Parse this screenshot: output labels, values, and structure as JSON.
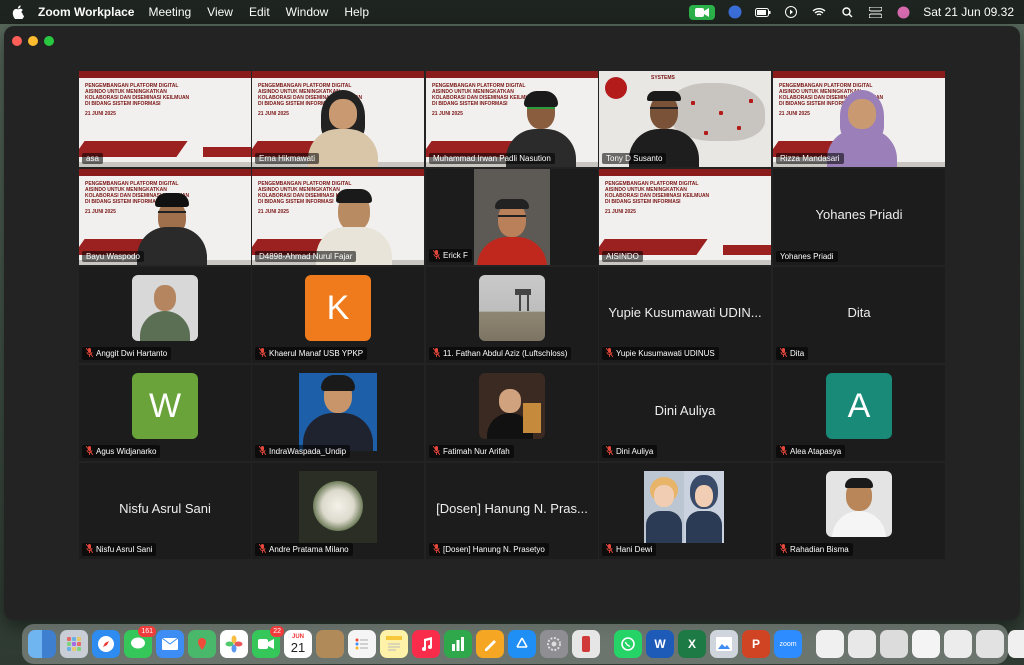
{
  "menubar": {
    "app_name": "Zoom Workplace",
    "menus": [
      "Meeting",
      "View",
      "Edit",
      "Window",
      "Help"
    ],
    "date_time": "Sat 21 Jun  09.32"
  },
  "slide": {
    "title": "PENGEMBANGAN PLATFORM DIGITAL AISINDO UNTUK MENINGKATKAN KOLABORASI DAN DISEMINASI KEILMUAN DI BIDANG SISTEM INFORMASI",
    "date": "21 JUNI 2025"
  },
  "map_slide": {
    "header": "SYSTEMS"
  },
  "participants": [
    {
      "name": "asa",
      "bigname": ""
    },
    {
      "name": "Erna Hikmawati",
      "bigname": ""
    },
    {
      "name": "Muhammad Irwan Padli Nasution",
      "bigname": ""
    },
    {
      "name": "Tony D Susanto",
      "bigname": ""
    },
    {
      "name": "Rizza Mandasari",
      "bigname": ""
    },
    {
      "name": "Bayu Waspodo",
      "bigname": ""
    },
    {
      "name": "D4898-Ahmad Nurul Fajar",
      "bigname": ""
    },
    {
      "name": "Erick F",
      "bigname": ""
    },
    {
      "name": "AISINDO",
      "bigname": ""
    },
    {
      "name": "Yohanes Priadi",
      "bigname": "Yohanes Priadi"
    },
    {
      "name": "Anggit Dwi Hartanto",
      "bigname": ""
    },
    {
      "name": "Khaerul Manaf USB YPKP",
      "bigname": "",
      "letter": "K"
    },
    {
      "name": "11. Fathan Abdul Aziz (Luftschloss)",
      "bigname": ""
    },
    {
      "name": "Yupie Kusumawati UDINUS",
      "bigname": "Yupie Kusumawati UDIN..."
    },
    {
      "name": "Dita",
      "bigname": "Dita"
    },
    {
      "name": "Agus Widjanarko",
      "bigname": "",
      "letter": "W"
    },
    {
      "name": "IndraWaspada_Undip",
      "bigname": ""
    },
    {
      "name": "Fatimah Nur Arifah",
      "bigname": ""
    },
    {
      "name": "Dini Auliya",
      "bigname": "Dini Auliya"
    },
    {
      "name": "Alea Atapasya",
      "bigname": "",
      "letter": "A"
    },
    {
      "name": "Nisfu Asrul Sani",
      "bigname": "Nisfu Asrul Sani"
    },
    {
      "name": "Andre Pratama Milano",
      "bigname": ""
    },
    {
      "name": "[Dosen] Hanung N. Prasetyo",
      "bigname": "[Dosen] Hanung N. Pras..."
    },
    {
      "name": "Hani Dewi",
      "bigname": ""
    },
    {
      "name": "Rahadian Bisma",
      "bigname": ""
    }
  ],
  "dock": {
    "messages_badge": "161",
    "calendar_month": "JUN",
    "calendar_day": "21",
    "facetime_badge": "22",
    "zoom_label": "zoom"
  },
  "colors": {
    "active_speaker": "#2bb34a",
    "mute_red": "#e5483b",
    "slide_red": "#8b1c1c",
    "avatar_orange": "#f07b1c",
    "avatar_green": "#6aa339",
    "avatar_teal": "#1a8a78"
  }
}
